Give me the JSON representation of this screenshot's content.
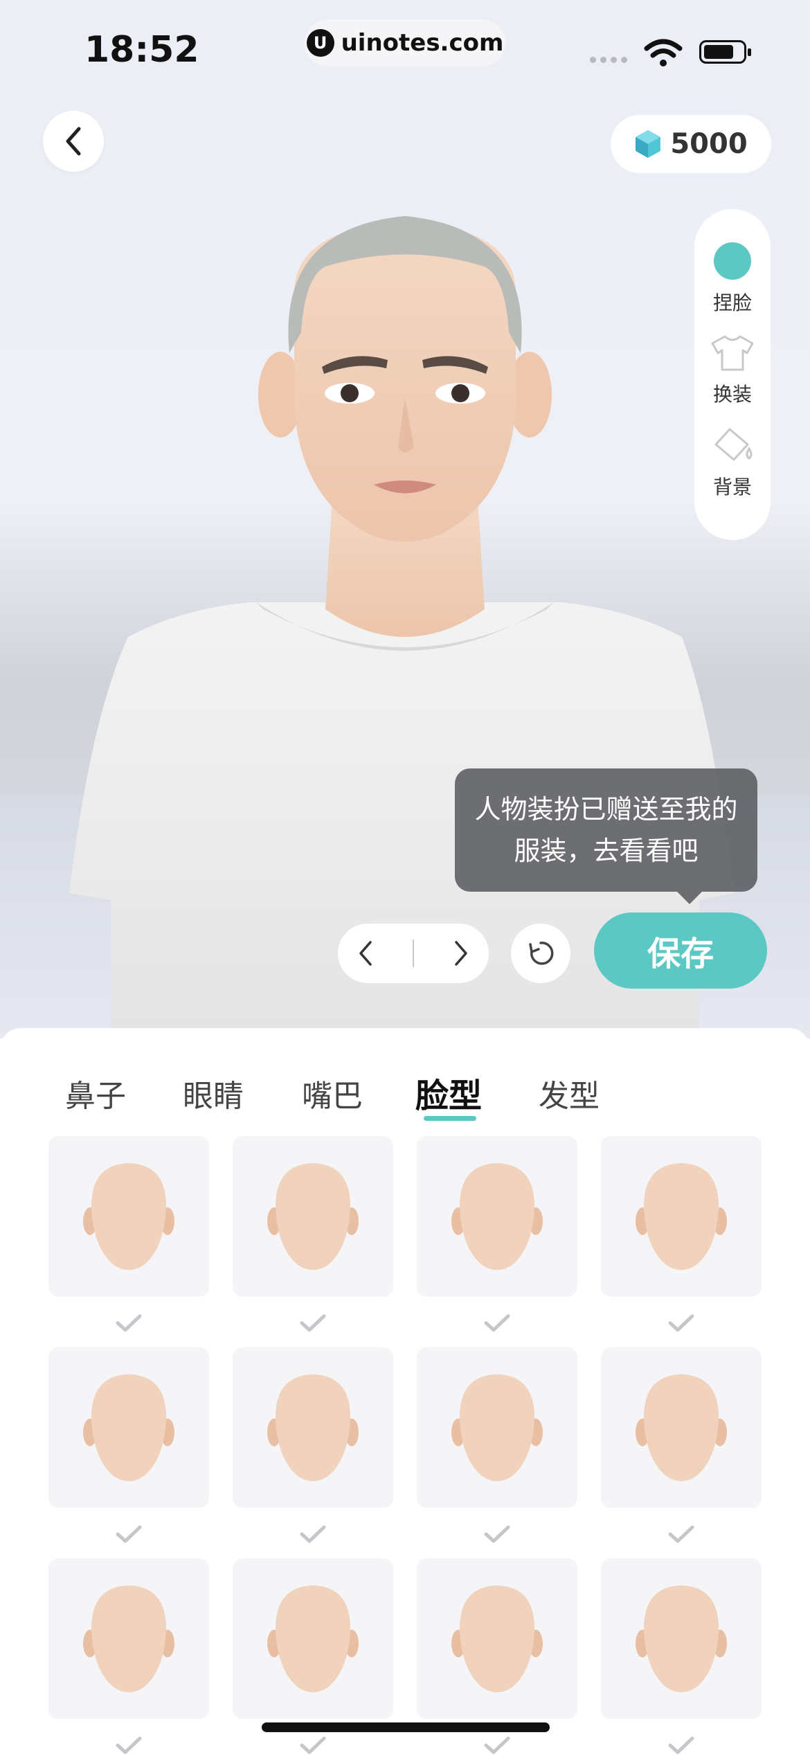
{
  "status_bar": {
    "time": "18:52",
    "url": "uinotes.com"
  },
  "header": {
    "coins": "5000"
  },
  "side_menu": {
    "items": [
      {
        "label": "捏脸"
      },
      {
        "label": "换装"
      },
      {
        "label": "背景"
      }
    ]
  },
  "tooltip": {
    "line1": "人物装扮已赠送至我的",
    "line2": "服装，去看看吧"
  },
  "actions": {
    "save_label": "保存"
  },
  "tabs": {
    "items": [
      {
        "label": "鼻子"
      },
      {
        "label": "眼睛"
      },
      {
        "label": "嘴巴"
      },
      {
        "label": "脸型",
        "active": true
      },
      {
        "label": "发型"
      }
    ]
  },
  "colors": {
    "accent": "#5bc8c4",
    "skin": "#f1d2bd"
  }
}
